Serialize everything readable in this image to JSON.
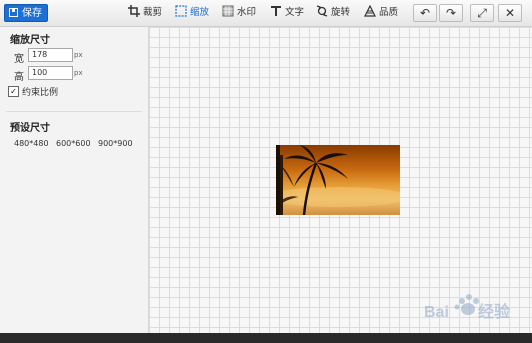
{
  "toolbar": {
    "save_label": "保存",
    "tools": [
      {
        "label": "裁剪",
        "icon": "crop-icon"
      },
      {
        "label": "缩放",
        "icon": "resize-icon",
        "active": true
      },
      {
        "label": "水印",
        "icon": "watermark-icon"
      },
      {
        "label": "文字",
        "icon": "text-icon"
      },
      {
        "label": "旋转",
        "icon": "rotate-icon"
      },
      {
        "label": "品质",
        "icon": "quality-icon"
      }
    ],
    "undo_icon": "undo-icon",
    "redo_icon": "redo-icon",
    "fullscreen_icon": "fullscreen-icon",
    "close_icon": "close-icon",
    "accent_color": "#1d6fd3"
  },
  "left_panel": {
    "resize_title": "缩放尺寸",
    "width_label": "宽",
    "width_value": "178",
    "height_label": "高",
    "height_value": "100",
    "unit": "px",
    "keep_ratio_label": "约束比例",
    "keep_ratio_checked": true,
    "preset_title": "预设尺寸",
    "presets": [
      "480*480",
      "600*600",
      "900*900"
    ]
  },
  "watermark": {
    "brand": "Baidu",
    "suffix": "经验"
  }
}
